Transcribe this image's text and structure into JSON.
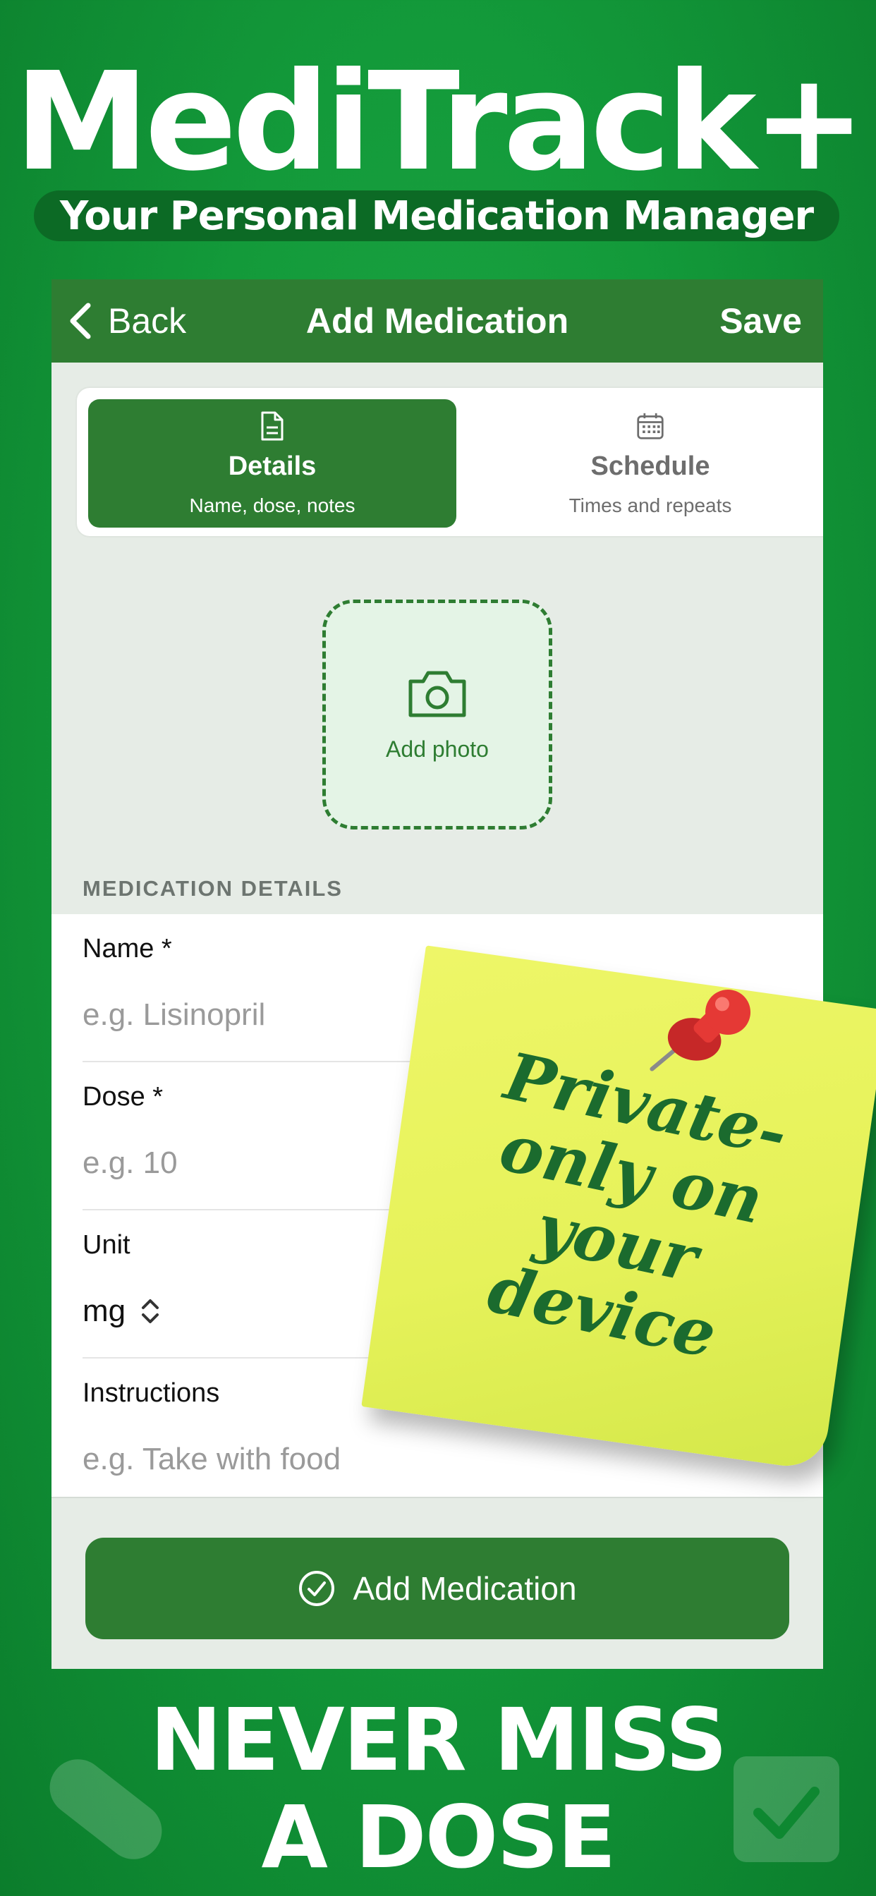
{
  "brand": {
    "title": "MediTrack+",
    "subtitle": "Your Personal Medication Manager"
  },
  "navbar": {
    "back_label": "Back",
    "title": "Add Medication",
    "save_label": "Save"
  },
  "tabs": [
    {
      "label": "Details",
      "sublabel": "Name, dose, notes",
      "icon": "document-icon",
      "selected": true
    },
    {
      "label": "Schedule",
      "sublabel": "Times and repeats",
      "icon": "calendar-icon",
      "selected": false
    }
  ],
  "photo": {
    "label": "Add photo",
    "icon": "camera-icon"
  },
  "section": {
    "header": "MEDICATION DETAILS"
  },
  "fields": {
    "name": {
      "label": "Name *",
      "placeholder": "e.g. Lisinopril"
    },
    "dose": {
      "label": "Dose *",
      "placeholder": "e.g. 10"
    },
    "unit": {
      "label": "Unit",
      "value": "mg",
      "icon": "up-down-chevron-icon"
    },
    "instructions": {
      "label": "Instructions",
      "placeholder": "e.g. Take with food"
    }
  },
  "primary_button": {
    "label": "Add Medication",
    "icon": "check-circle-icon"
  },
  "sticky_note": {
    "text": "Private-\nonly on\nyour\ndevice"
  },
  "tagline": {
    "line1": "NEVER MISS",
    "line2": "A DOSE"
  },
  "colors": {
    "background": "#139a3a",
    "primary": "#2e7d32",
    "note": "#e6f25a",
    "pin": "#d32f2f"
  }
}
